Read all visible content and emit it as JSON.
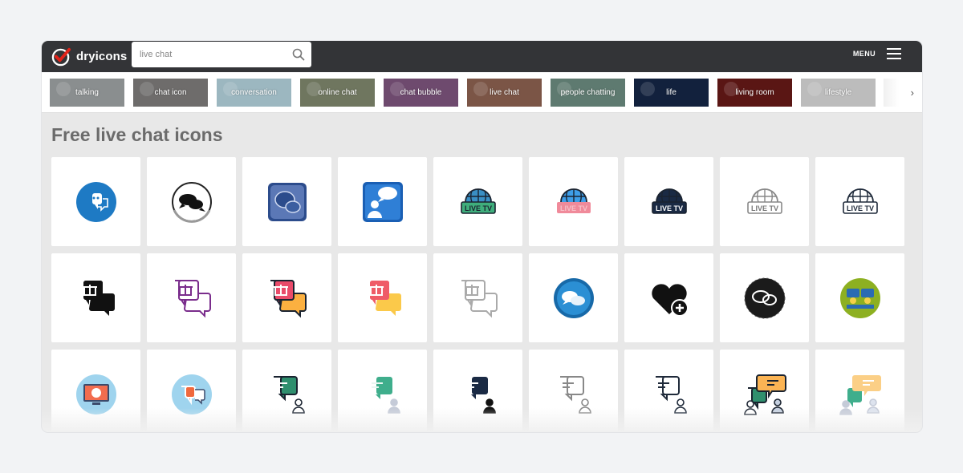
{
  "header": {
    "logo_text": "dryicons",
    "search": {
      "value": "live chat",
      "placeholder": ""
    },
    "menu_label": "MENU"
  },
  "tags": [
    {
      "label": "talking",
      "color": "#8a8e8f"
    },
    {
      "label": "chat icon",
      "color": "#6e6c6b"
    },
    {
      "label": "conversation",
      "color": "#9cb7c0"
    },
    {
      "label": "online chat",
      "color": "#6f765f"
    },
    {
      "label": "chat bubble",
      "color": "#6e4a6e"
    },
    {
      "label": "live chat",
      "color": "#7b5546"
    },
    {
      "label": "people chatting",
      "color": "#5e7a70"
    },
    {
      "label": "life",
      "color": "#12213d"
    },
    {
      "label": "living room",
      "color": "#5a1614"
    },
    {
      "label": "lifestyle",
      "color": "#bcbcbc"
    }
  ],
  "page_title": "Free live chat icons",
  "icons": [
    {
      "name": "blue-circle-chat-icon"
    },
    {
      "name": "black-chat-bubbles-icon"
    },
    {
      "name": "blue-square-chat-icon"
    },
    {
      "name": "blue-user-chat-icon"
    },
    {
      "name": "live-tv-green-icon",
      "text": "LIVE TV"
    },
    {
      "name": "live-tv-pink-icon",
      "text": "LIVE TV"
    },
    {
      "name": "live-tv-dark-icon",
      "text": "LIVE TV"
    },
    {
      "name": "live-tv-outline-gray-icon",
      "text": "LIVE TV"
    },
    {
      "name": "live-tv-outline-dark-icon",
      "text": "LIVE TV"
    },
    {
      "name": "gift-chat-black-icon"
    },
    {
      "name": "gift-chat-purple-icon"
    },
    {
      "name": "gift-chat-color-icon"
    },
    {
      "name": "gift-chat-flat-icon"
    },
    {
      "name": "gift-chat-outline-icon"
    },
    {
      "name": "blue-sphere-chat-icon"
    },
    {
      "name": "heart-plus-icon"
    },
    {
      "name": "sketch-chat-circle-icon"
    },
    {
      "name": "green-circle-chat-icon"
    },
    {
      "name": "monitor-chat-icon"
    },
    {
      "name": "circle-orange-chat-icon"
    },
    {
      "name": "user-chat-green-icon"
    },
    {
      "name": "user-chat-teal-icon"
    },
    {
      "name": "user-chat-dark-icon"
    },
    {
      "name": "user-chat-outline-gray-icon"
    },
    {
      "name": "user-chat-outline-dark-icon"
    },
    {
      "name": "group-chat-color-icon"
    },
    {
      "name": "group-chat-light-icon"
    }
  ],
  "colors": {
    "topbar": "#333437",
    "logo_red": "#e2231a",
    "title": "#6b6b6b"
  }
}
